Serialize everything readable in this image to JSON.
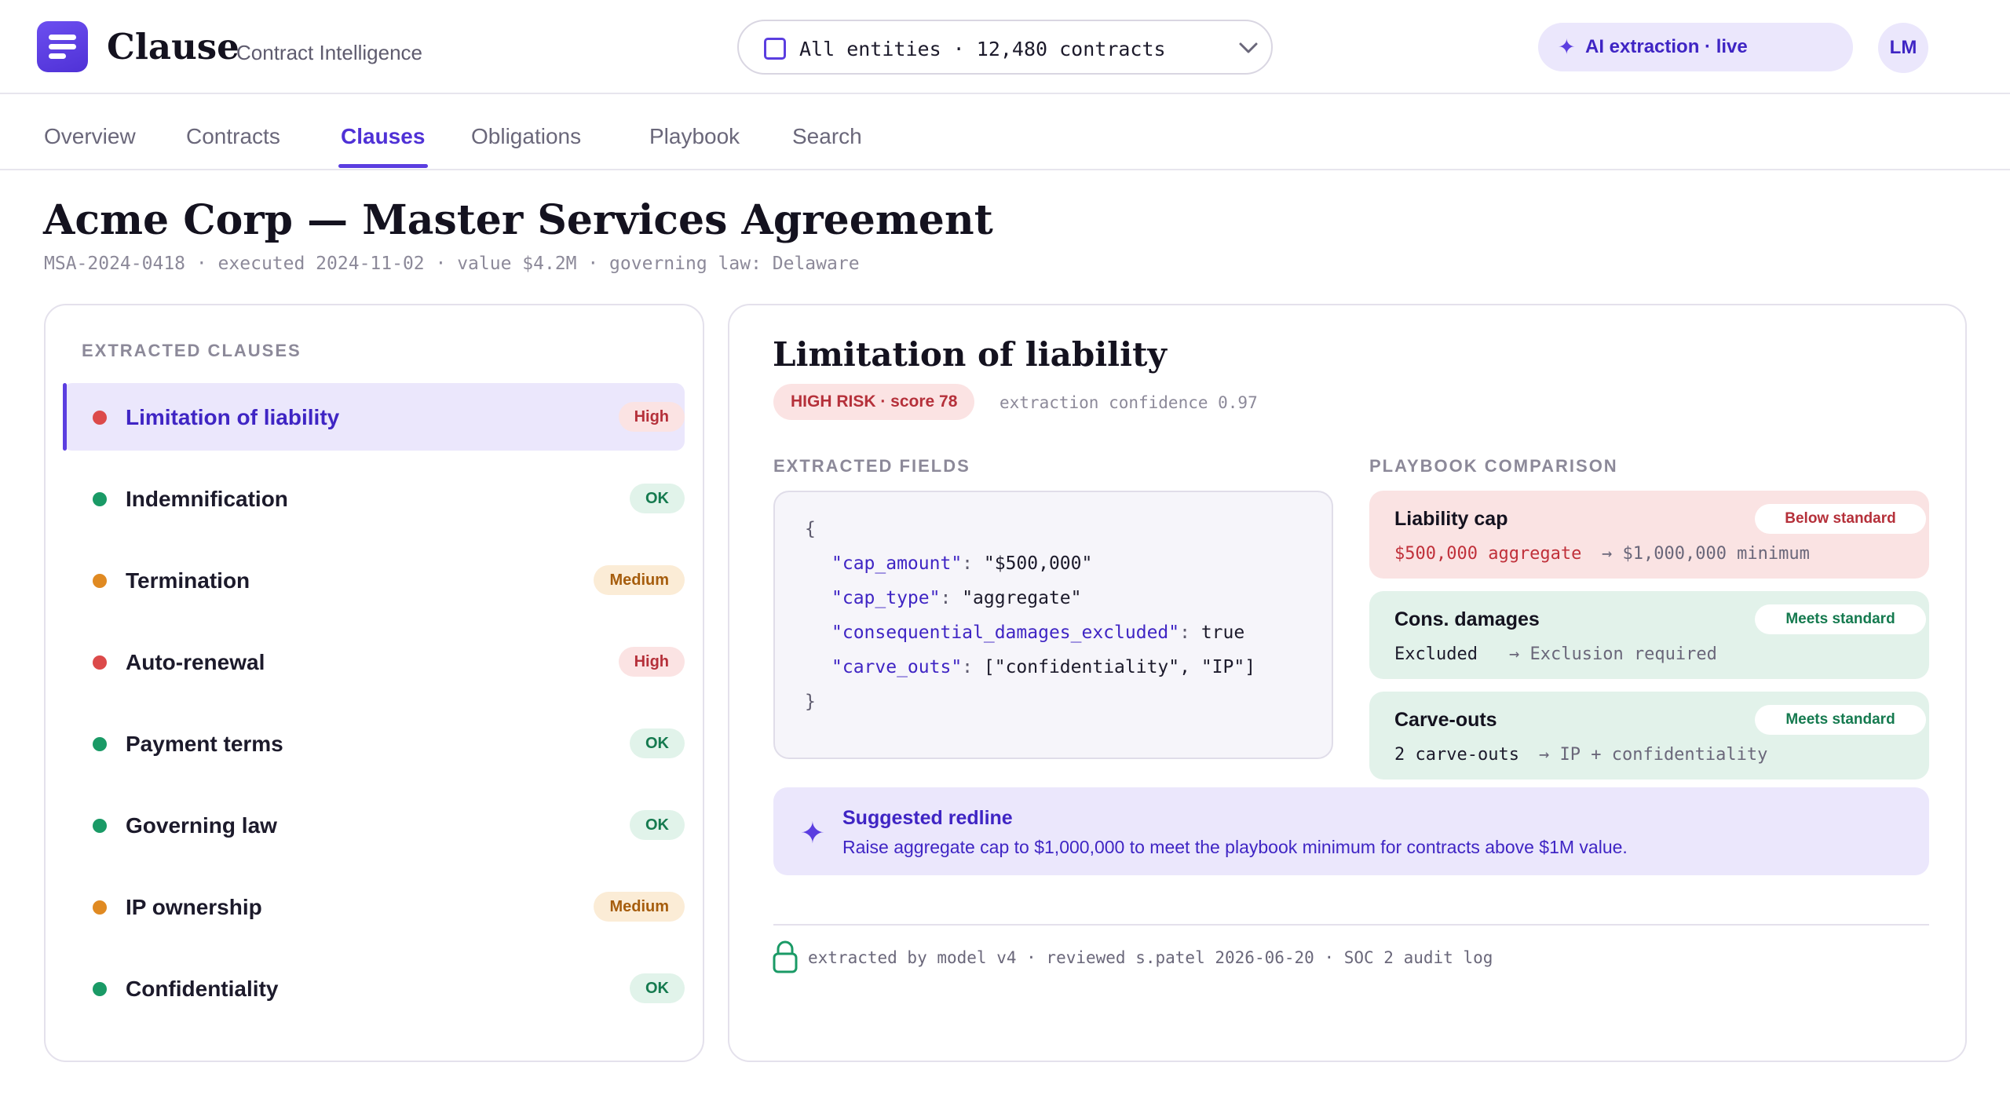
{
  "app": {
    "name": "Clause",
    "subtitle": "Contract Intelligence",
    "entity_selector": "All entities · 12,480 contracts",
    "ai_status": "AI extraction · live",
    "avatar_initials": "LM"
  },
  "tabs": [
    {
      "label": "Overview"
    },
    {
      "label": "Contracts"
    },
    {
      "label": "Clauses",
      "active": true
    },
    {
      "label": "Obligations"
    },
    {
      "label": "Playbook"
    },
    {
      "label": "Search"
    }
  ],
  "contract": {
    "title": "Acme Corp — Master Services Agreement",
    "meta": "MSA-2024-0418 · executed 2024-11-02 · value $4.2M · governing law: Delaware"
  },
  "clauses_panel": {
    "heading": "EXTRACTED CLAUSES",
    "items": [
      {
        "name": "Limitation of liability",
        "risk": "High",
        "color": "#dc4a4a",
        "selected": true
      },
      {
        "name": "Indemnification",
        "risk": "OK",
        "color": "#1a9a66"
      },
      {
        "name": "Termination",
        "risk": "Medium",
        "color": "#e08a22"
      },
      {
        "name": "Auto-renewal",
        "risk": "High",
        "color": "#dc4a4a"
      },
      {
        "name": "Payment terms",
        "risk": "OK",
        "color": "#1a9a66"
      },
      {
        "name": "Governing law",
        "risk": "OK",
        "color": "#1a9a66"
      },
      {
        "name": "IP ownership",
        "risk": "Medium",
        "color": "#e08a22"
      },
      {
        "name": "Confidentiality",
        "risk": "OK",
        "color": "#1a9a66"
      }
    ]
  },
  "detail": {
    "title": "Limitation of liability",
    "risk_pill": "HIGH RISK · score 78",
    "confidence": "extraction confidence 0.97",
    "fields_heading": "EXTRACTED FIELDS",
    "playbook_heading": "PLAYBOOK COMPARISON",
    "json_open": "{",
    "json_close": "}",
    "fields": [
      {
        "key": "\"cap_amount\"",
        "value": "\"$500,000\""
      },
      {
        "key": "\"cap_type\"",
        "value": "\"aggregate\""
      },
      {
        "key": "\"consequential_damages_excluded\"",
        "value": "true"
      },
      {
        "key": "\"carve_outs\"",
        "value": "[\"confidentiality\", \"IP\"]"
      }
    ],
    "comparisons": [
      {
        "title": "Liability cap",
        "status": "Below standard",
        "state": "fail",
        "value": "$500,000 aggregate",
        "standard": "→ $1,000,000 minimum"
      },
      {
        "title": "Cons. damages",
        "status": "Meets standard",
        "state": "pass",
        "value": "Excluded",
        "standard": "→ Exclusion required"
      },
      {
        "title": "Carve-outs",
        "status": "Meets standard",
        "state": "pass",
        "value": "2 carve-outs",
        "standard": "→ IP + confidentiality"
      }
    ],
    "redline_title": "Suggested redline",
    "redline_text": "Raise aggregate cap to $1,000,000 to meet the playbook minimum for contracts above $1M value.",
    "audit": "extracted by model v4 · reviewed s.patel 2026-06-20 · SOC 2 audit log"
  },
  "colors": {
    "accent": "#5b3ee0",
    "high": "#dc4a4a",
    "ok": "#1a9a66",
    "medium": "#e08a22"
  },
  "icons": {
    "logo": "menu-lines-icon",
    "entity": "checkbox-icon",
    "dropdown": "chevron-down-icon",
    "ai": "sparkle-icon",
    "audit": "lock-icon"
  }
}
